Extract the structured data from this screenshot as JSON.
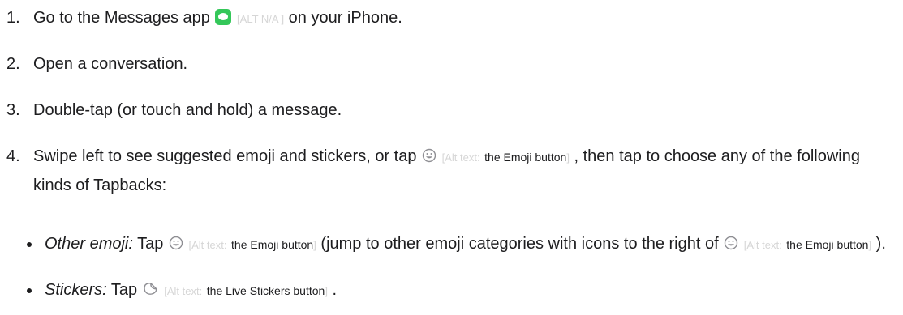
{
  "steps": [
    {
      "number": "1.",
      "before": "Go to the Messages app",
      "alt": "[ALT N/A ]",
      "after": "on your iPhone."
    },
    {
      "number": "2.",
      "text": "Open a conversation."
    },
    {
      "number": "3.",
      "text": "Double-tap (or touch and hold) a message."
    },
    {
      "number": "4.",
      "before": "Swipe left to see suggested emoji and stickers, or tap",
      "alt_prefix": "[Alt text:",
      "alt_name": "the Emoji button",
      "alt_close": "]",
      "after": ", then tap to choose any of the following kinds of Tapbacks:"
    }
  ],
  "bullets": [
    {
      "term": "Other emoji:",
      "before": "Tap",
      "alt_prefix": "[Alt text:",
      "alt_name": "the Emoji button",
      "alt_close": "]",
      "middle": "(jump to other emoji categories with icons to the right of",
      "alt2_prefix": "[Alt text:",
      "alt2_name": "the Emoji button",
      "alt2_close": "]",
      "after": ")."
    },
    {
      "term": "Stickers:",
      "before": "Tap",
      "alt_prefix": "[Alt text:",
      "alt_name": "the Live Stickers button",
      "alt_close": "]",
      "after": "."
    }
  ],
  "icons": {
    "messages": "messages-app-icon",
    "emoji": "emoji-button-icon",
    "stickers": "live-stickers-icon"
  },
  "colors": {
    "text": "#1d1d1f",
    "alt_text": "#d6d6d6",
    "messages_green": "#34c759"
  }
}
